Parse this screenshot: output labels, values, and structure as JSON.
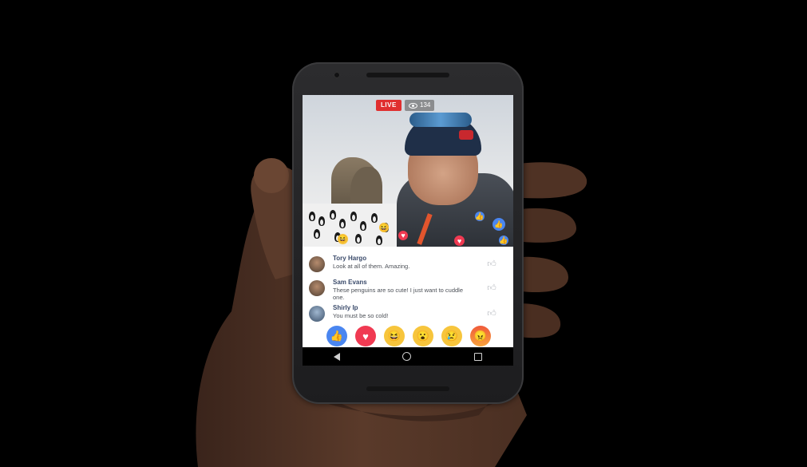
{
  "video": {
    "live_label": "LIVE",
    "viewer_count": "134"
  },
  "comments": [
    {
      "name": "Tory Hargo",
      "text": "Look at all of them. Amazing."
    },
    {
      "name": "Sam Evans",
      "text": "These penguins are so cute! I just want to cuddle one."
    },
    {
      "name": "Shirly Ip",
      "text": "You must be so cold!"
    }
  ],
  "reactions": [
    "like-icon",
    "love-icon",
    "haha-icon",
    "wow-icon",
    "sad-icon",
    "angry-icon"
  ],
  "colors": {
    "live": "#e02f2f",
    "like": "#4a86f0",
    "love": "#f03a52",
    "reaction_yellow": "#f7c53c"
  }
}
